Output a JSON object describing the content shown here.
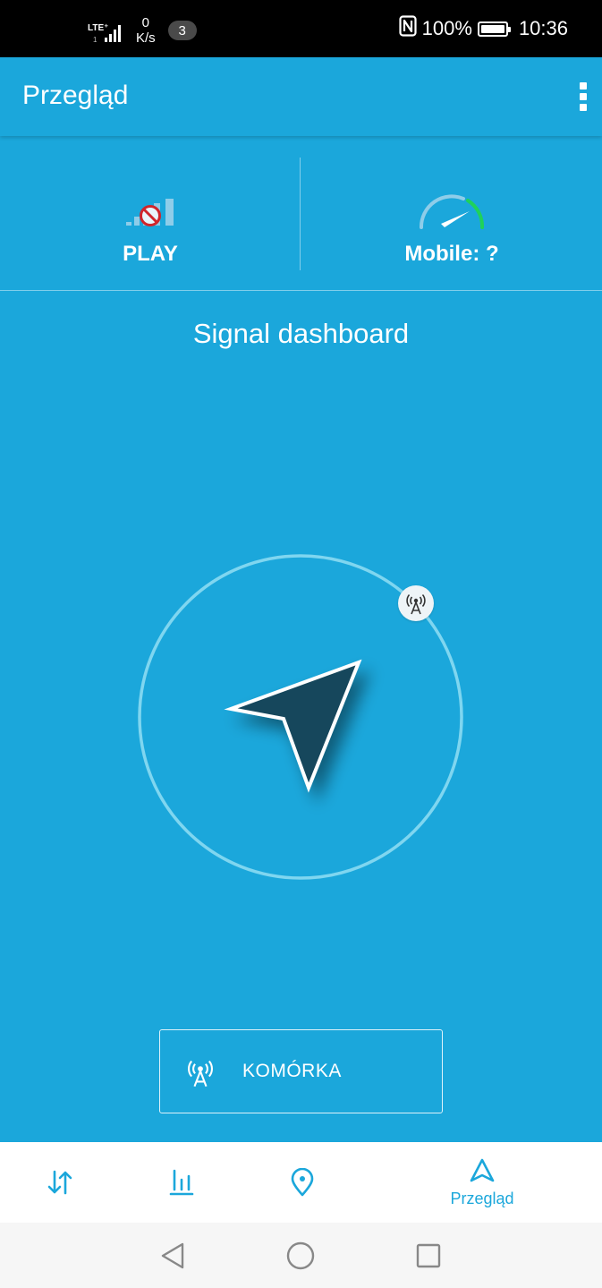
{
  "status_bar": {
    "network_type": "LTE⁺",
    "network_sub": "1",
    "speed_value": "0",
    "speed_unit": "K/s",
    "notification_count": "3",
    "battery_percent": "100%",
    "battery_level": 1.0,
    "time": "10:36",
    "icons": [
      "lte-signal-icon",
      "nfc-icon",
      "battery-icon"
    ]
  },
  "app_bar": {
    "title": "Przegląd",
    "overflow_icon": "overflow-menu-icon"
  },
  "info": {
    "operator": {
      "label": "PLAY",
      "icon": "no-signal-icon"
    },
    "connection": {
      "label": "Mobile: ?",
      "icon": "speedometer-icon"
    }
  },
  "dashboard": {
    "title": "Signal dashboard",
    "tower_icon": "cell-tower-icon",
    "arrow_icon": "navigation-arrow-icon"
  },
  "cell_button": {
    "label": "KOMÓRKA",
    "icon": "cell-tower-icon"
  },
  "bottom_nav": {
    "items": [
      {
        "icon": "transfer-arrows-icon",
        "label": ""
      },
      {
        "icon": "bar-chart-icon",
        "label": ""
      },
      {
        "icon": "map-pin-icon",
        "label": ""
      },
      {
        "icon": "navigation-icon",
        "label": "Przegląd",
        "active": true
      }
    ]
  },
  "system_nav": {
    "icons": [
      "back-triangle-icon",
      "home-circle-icon",
      "recents-square-icon"
    ]
  },
  "colors": {
    "primary": "#1ba7db",
    "arrow_fill": "#16475c",
    "speed_green": "#1fd25a",
    "no_signal_red": "#d0252b"
  }
}
